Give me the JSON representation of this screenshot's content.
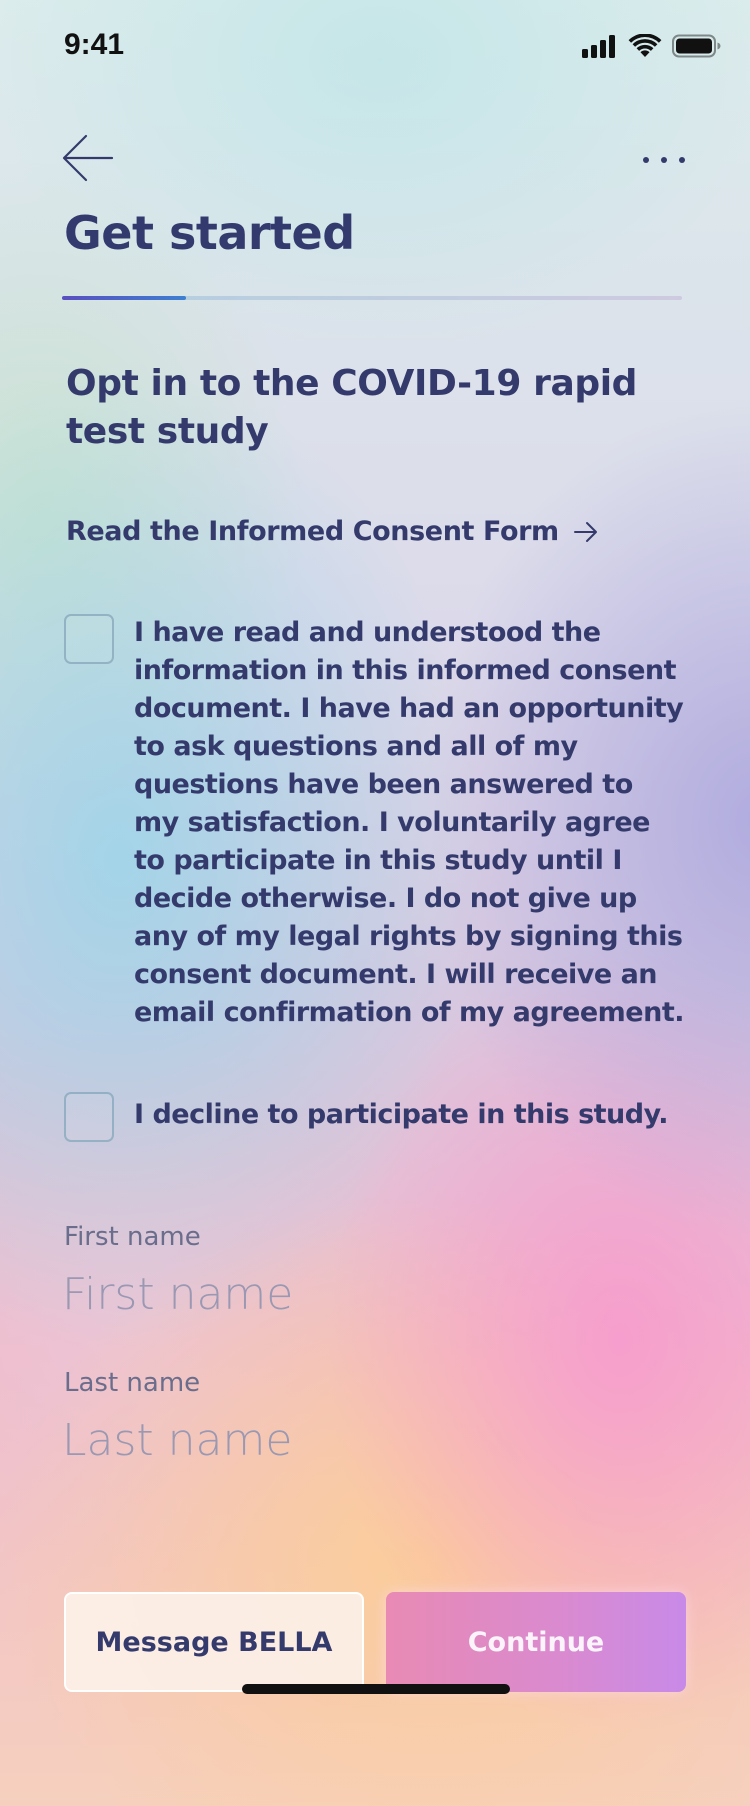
{
  "status_bar": {
    "time": "9:41"
  },
  "header": {
    "title": "Get started",
    "progress": 0.2
  },
  "main": {
    "heading": "Opt in to the COVID-19 rapid test study",
    "consent_link_label": "Read the Informed Consent Form",
    "agree_label": "I have read and understood the information in this informed consent document. I have had an opportunity to ask questions and all of my questions have been answered to my satisfaction. I voluntarily agree to participate in this study until I decide otherwise. I do not give up any of my legal rights by signing this consent document. I will receive an email confirmation of my agreement.",
    "agree_checked": false,
    "decline_label": "I decline to participate in this study.",
    "decline_checked": false
  },
  "form": {
    "first_name_label": "First name",
    "first_name_placeholder": "First name",
    "first_name_value": "",
    "last_name_label": "Last name",
    "last_name_placeholder": "Last name",
    "last_name_value": ""
  },
  "actions": {
    "message_label": "Message BELLA",
    "continue_label": "Continue"
  },
  "icons": {
    "back": "arrow-left-icon",
    "more": "more-horizontal-icon",
    "link_arrow": "arrow-right-icon",
    "signal": "cellular-signal-icon",
    "wifi": "wifi-icon",
    "battery": "battery-icon"
  },
  "colors": {
    "text_primary": "#343b6c",
    "progress_fill": "#3d7fd0",
    "continue_gradient_start": "#e88ab4",
    "continue_gradient_end": "#c88ae8"
  }
}
